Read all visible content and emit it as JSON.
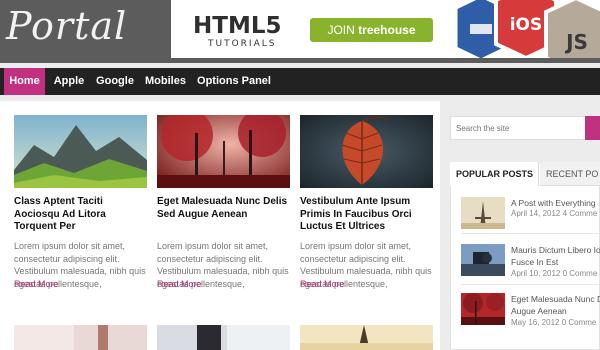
{
  "header": {
    "logo": "Portal",
    "ad": {
      "title": "HTML5",
      "subtitle": "TUTORIALS",
      "button_prefix": "JOIN",
      "button_brand": "treehouse",
      "badges": [
        "iOS",
        "JS"
      ]
    }
  },
  "nav": {
    "items": [
      {
        "label": "Home",
        "active": true
      },
      {
        "label": "Apple"
      },
      {
        "label": "Google"
      },
      {
        "label": "Mobiles"
      },
      {
        "label": "Options Panel »"
      }
    ]
  },
  "posts": [
    {
      "title": "Class Aptent Taciti Aociosqu Ad Litora Torquent Per",
      "excerpt": "Lorem ipsum dolor sit amet, consectetur adipiscing elit. Vestibulum malesuada, nibh quis egestas pellentesque,",
      "read_more": "Read More",
      "image": "mountain-landscape"
    },
    {
      "title": "Eget Malesuada Nunc Delis Sed Augue Aenean",
      "excerpt": "Lorem ipsum dolor sit amet, consectetur adipiscing elit. Vestibulum malesuada, nibh quis egestas pellentesque,",
      "read_more": "Read More",
      "image": "red-autumn-forest"
    },
    {
      "title": "Vestibulum Ante Ipsum Primis In Faucibus Orci Luctus Et Ultrices",
      "excerpt": "Lorem ipsum dolor sit amet, consectetur adipiscing elit. Vestibulum malesuada, nibh quis egestas pellentesque,",
      "read_more": "Read More",
      "image": "autumn-leaf"
    }
  ],
  "sidebar": {
    "search_placeholder": "Search the site",
    "tabs": [
      "POPULAR POSTS",
      "RECENT PO"
    ],
    "popular": [
      {
        "title": "A Post with Everything",
        "meta": "April 14, 2012   4 Comme"
      },
      {
        "title_lines": [
          "Mauris Dictum Libero Io",
          "Fusce In Est"
        ],
        "meta": "April 10, 2012   0 Comme"
      },
      {
        "title_lines": [
          "Eget Malesuada Nunc D",
          "Augue Aenean"
        ],
        "meta": "May 16, 2012   0 Comme"
      }
    ]
  },
  "colors": {
    "accent": "#c2317f",
    "header_bg": "#5c5c5c",
    "nav_bg": "#222222",
    "treehouse_green": "#8ab32d"
  }
}
